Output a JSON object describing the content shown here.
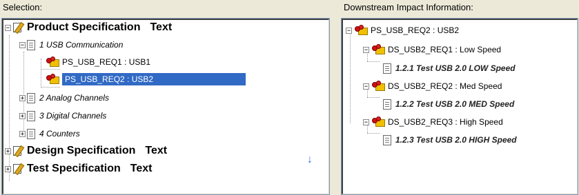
{
  "panels": {
    "left_header": "Selection:",
    "right_header": "Downstream Impact Information:"
  },
  "left_tree": {
    "product_spec": "Product Specification",
    "product_text": "Text",
    "usb_comm": "1 USB Communication",
    "req1": "PS_USB_REQ1 : USB1",
    "req2": "PS_USB_REQ2 : USB2",
    "analog": "2 Analog Channels",
    "digital": "3 Digital Channels",
    "counters": "4 Counters",
    "design_spec": "Design Specification",
    "design_text": "Text",
    "test_spec": "Test Specification",
    "test_text": "Text",
    "scroll_icon": "down-arrow-icon"
  },
  "right_tree": {
    "root": "PS_USB_REQ2 : USB2",
    "ds1": "DS_USB2_REQ1 : Low Speed",
    "t1": "1.2.1 Test USB 2.0 LOW Speed",
    "ds2": "DS_USB2_REQ2 : Med Speed",
    "t2": "1.2.2 Test USB 2.0 MED Speed",
    "ds3": "DS_USB2_REQ3 : High Speed",
    "t3": "1.2.3 Test USB 2.0 HIGH Speed"
  },
  "colors": {
    "selection_bg": "#316ac5",
    "window_bg": "#ece9d8",
    "arrow": "#3a6ee8"
  }
}
